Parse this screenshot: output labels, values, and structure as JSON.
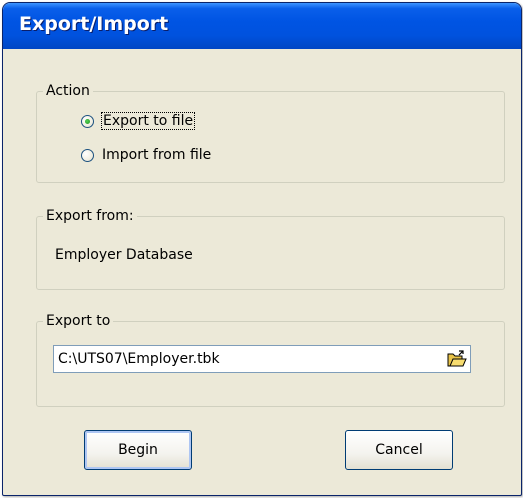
{
  "window": {
    "title": "Export/Import"
  },
  "action_group": {
    "legend": "Action",
    "options": [
      {
        "label": "Export to file",
        "checked": true
      },
      {
        "label": "Import from file",
        "checked": false
      }
    ]
  },
  "export_from": {
    "legend": "Export from:",
    "value": "Employer Database"
  },
  "export_to": {
    "legend": "Export to",
    "path": "C:\\UTS07\\Employer.tbk",
    "browse_icon": "open-folder-icon"
  },
  "buttons": {
    "begin": "Begin",
    "cancel": "Cancel"
  },
  "colors": {
    "titlebar": "#0054e3",
    "dialog_bg": "#ece9d8",
    "radio_dot": "#21a121"
  }
}
